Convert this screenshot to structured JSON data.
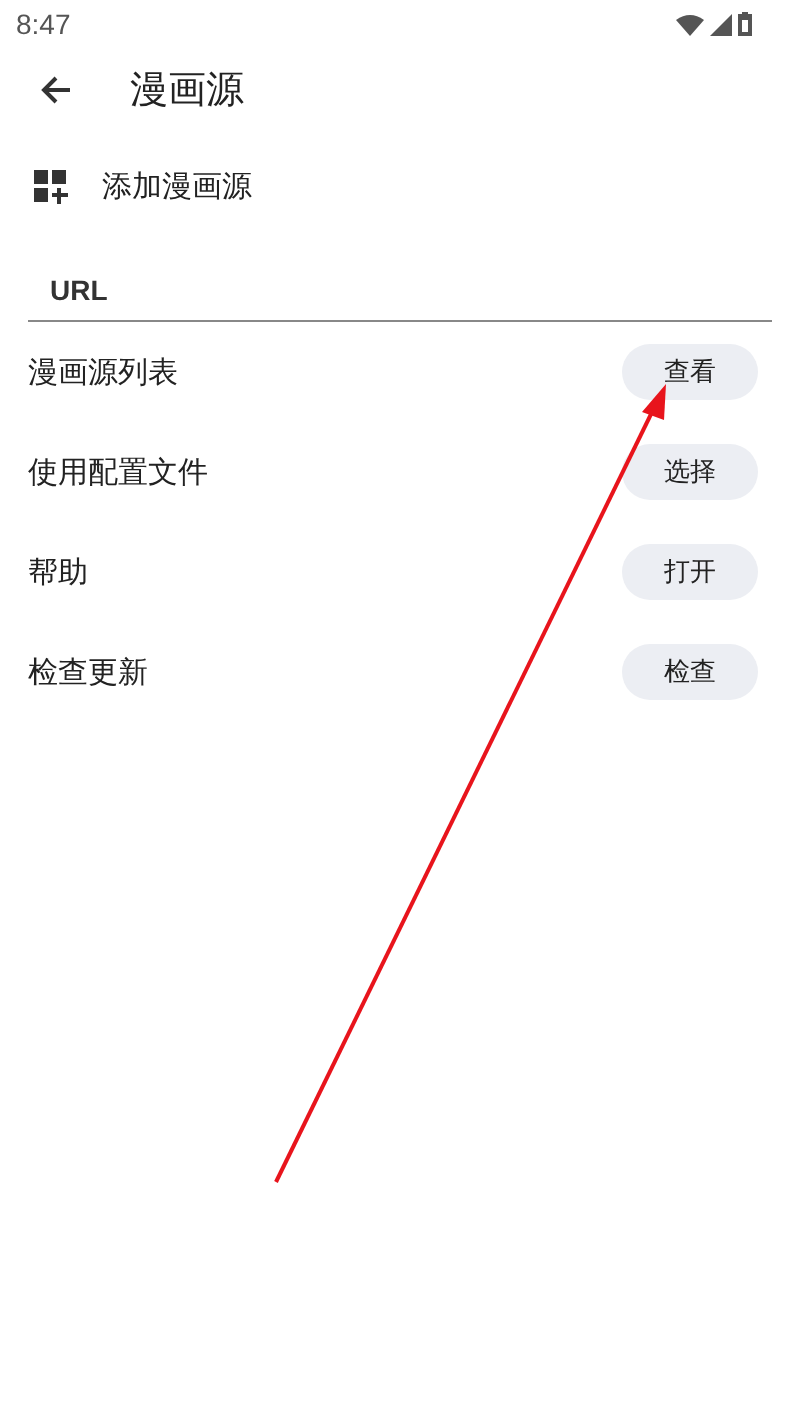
{
  "status_bar": {
    "time": "8:47"
  },
  "app_bar": {
    "title": "漫画源"
  },
  "add_item": {
    "label": "添加漫画源"
  },
  "url_field": {
    "placeholder": "URL"
  },
  "settings": [
    {
      "label": "漫画源列表",
      "button": "查看"
    },
    {
      "label": "使用配置文件",
      "button": "选择"
    },
    {
      "label": "帮助",
      "button": "打开"
    },
    {
      "label": "检查更新",
      "button": "检查"
    }
  ]
}
